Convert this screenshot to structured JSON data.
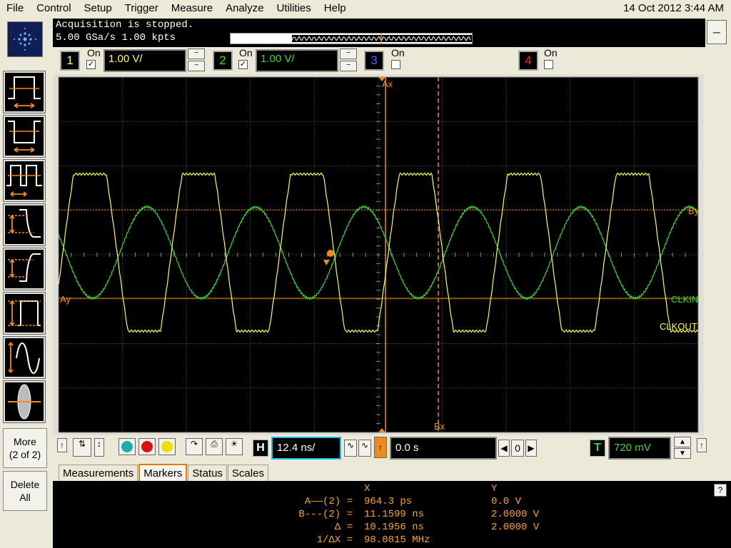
{
  "menu": [
    "File",
    "Control",
    "Setup",
    "Trigger",
    "Measure",
    "Analyze",
    "Utilities",
    "Help"
  ],
  "datetime": "14 Oct 2012  3:44 AM",
  "status": {
    "line1": "Acquisition is stopped.",
    "line2": "5.00 GSa/s   1.00 kpts"
  },
  "channels": [
    {
      "num": "1",
      "on_label": "On",
      "checked": true,
      "scale": "1.00 V/",
      "color": "#ffff44"
    },
    {
      "num": "2",
      "on_label": "On",
      "checked": true,
      "scale": "1.00 V/",
      "color": "#33dd33"
    },
    {
      "num": "3",
      "on_label": "On",
      "checked": false,
      "color": "#4466ff"
    },
    {
      "num": "4",
      "on_label": "On",
      "checked": false,
      "color": "#ff2244"
    }
  ],
  "side": {
    "more_line1": "More",
    "more_line2": "(2 of 2)",
    "delete_line1": "Delete",
    "delete_line2": "All"
  },
  "graticule": {
    "marker_ax": "Ax",
    "marker_bx": "Bx",
    "marker_ay": "Ay",
    "marker_by": "By",
    "label_clkin": "CLKIN",
    "label_clkout": "CLKOUT",
    "trig_label": "T",
    "ch2_ground": "2",
    "ch1_ground": "1"
  },
  "horizontal": {
    "h_label": "H",
    "timebase": "12.4 ns/",
    "delay": "0.0 s",
    "ref_value": "0"
  },
  "trigger": {
    "t_label": "T",
    "level": "720 mV"
  },
  "tabs": [
    "Measurements",
    "Markers",
    "Status",
    "Scales"
  ],
  "active_tab": "Markers",
  "markers": {
    "header_x": "X",
    "header_y": "Y",
    "rows": [
      {
        "label": "A——(2) =",
        "x": "964.3 ps",
        "y": "0.0 V"
      },
      {
        "label": "B---(2) =",
        "x": "11.1599 ns",
        "y": "2.0000 V"
      },
      {
        "label": "Δ =",
        "x": "10.1956 ns",
        "y": "2.0000 V"
      },
      {
        "label": "1/ΔX =",
        "x": "98.0815 MHz",
        "y": ""
      }
    ]
  },
  "help_label": "?",
  "colors": {
    "marker_orange": "#f08a1c",
    "ch1": "#ffff44",
    "ch2": "#33dd33"
  }
}
